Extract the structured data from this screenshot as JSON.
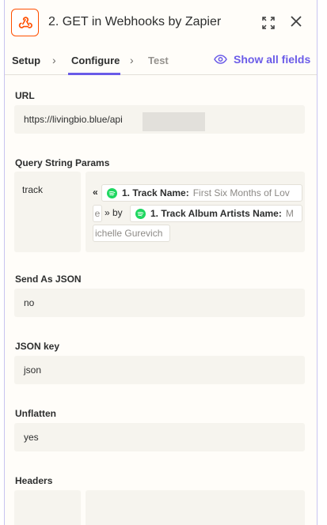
{
  "header": {
    "title": "2. GET in Webhooks by Zapier",
    "app_icon": "webhook-icon",
    "brand_color": "#ff4f00"
  },
  "tabs": {
    "setup": "Setup",
    "configure": "Configure",
    "test": "Test",
    "show_all_fields": "Show all fields",
    "accent_color": "#695be8"
  },
  "fields": {
    "url": {
      "label": "URL",
      "value": "https://livingbio.blue/api"
    },
    "query_params": {
      "label": "Query String Params",
      "key": "track",
      "open_quote": "«",
      "track_name_label": "1. Track Name:",
      "track_name_value": "First Six Months of Lov",
      "cont_e": "e",
      "by_text": "» by",
      "artists_label": "1. Track Album Artists Name:",
      "artists_value_start": "M",
      "artists_value_end": "ichelle Gurevich"
    },
    "send_as_json": {
      "label": "Send As JSON",
      "value": "no"
    },
    "json_key": {
      "label": "JSON key",
      "value": "json"
    },
    "unflatten": {
      "label": "Unflatten",
      "value": "yes"
    },
    "headers": {
      "label": "Headers"
    }
  }
}
